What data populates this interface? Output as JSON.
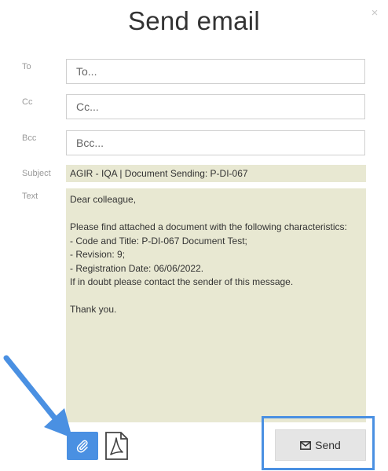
{
  "dialog": {
    "title": "Send email",
    "close_icon": "×"
  },
  "fields": {
    "to": {
      "label": "To",
      "value": "",
      "placeholder": "To..."
    },
    "cc": {
      "label": "Cc",
      "value": "",
      "placeholder": "Cc..."
    },
    "bcc": {
      "label": "Bcc",
      "value": "",
      "placeholder": "Bcc..."
    },
    "subject": {
      "label": "Subject",
      "value": "AGIR - IQA | Document Sending: P-DI-067"
    },
    "text": {
      "label": "Text",
      "lines": [
        "Dear colleague,",
        "",
        "Please find attached a document with the following characteristics:",
        "- Code and Title: P-DI-067 Document Test;",
        "- Revision: 9;",
        "- Registration Date: 06/06/2022.",
        "If in doubt please contact the sender of this message.",
        "",
        "Thank you."
      ]
    }
  },
  "actions": {
    "attach_icon": "paperclip-icon",
    "pdf_icon": "pdf-file-icon",
    "send_label": "Send",
    "send_icon": "envelope-icon"
  },
  "colors": {
    "accent": "#4a90e2",
    "text_area_bg": "#e8e8d2",
    "send_bg": "#e5e5e5"
  }
}
